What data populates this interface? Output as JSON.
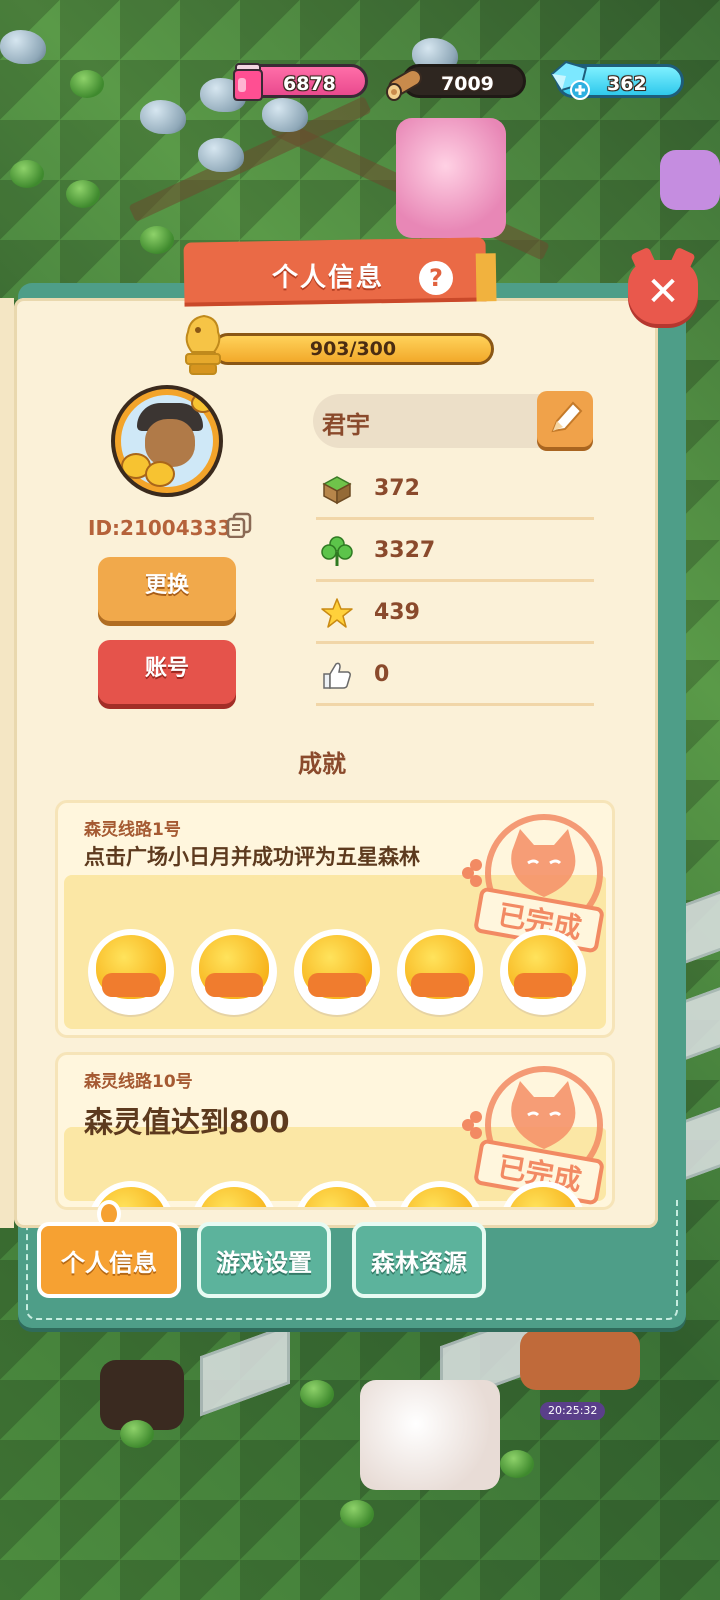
{
  "resources": {
    "ink": {
      "value": "6878",
      "icon": "ink-jar-icon"
    },
    "wood": {
      "value": "7009",
      "icon": "wood-log-icon"
    },
    "gem": {
      "value": "362",
      "icon": "blue-gem-plus-icon"
    }
  },
  "panel": {
    "title": "个人信息",
    "help_label": "?",
    "close_label": "✕"
  },
  "profile": {
    "level_progress_text": "903/300",
    "level_progress_fraction": 1.0,
    "user_id": "ID:21004333",
    "name": "君宇",
    "change_button": "更换",
    "account_button": "账号",
    "stats": [
      {
        "icon": "grass-block-icon",
        "value": "372"
      },
      {
        "icon": "clover-icon",
        "value": "3327"
      },
      {
        "icon": "star-icon",
        "value": "439"
      },
      {
        "icon": "thumbs-up-icon",
        "value": "0"
      }
    ]
  },
  "achievements": {
    "heading": "成就",
    "items": [
      {
        "subtitle": "森灵线路1号",
        "description": "点击广场小日月并成功评为五星森林",
        "stamp": "已完成",
        "rewards": 5
      },
      {
        "subtitle": "森灵线路10号",
        "description": "森灵值达到800",
        "stamp": "已完成",
        "rewards": 5
      }
    ]
  },
  "tabs": [
    {
      "label": "个人信息",
      "active": true
    },
    {
      "label": "游戏设置",
      "active": false
    },
    {
      "label": "森林资源",
      "active": false
    }
  ],
  "clock": "20:25:32",
  "colors": {
    "panel_green": "#4e9e88",
    "page_cream": "#fbf1d8",
    "title_orange": "#ea6a46",
    "text_brown": "#8a4a2c",
    "account_red": "#e5534b",
    "change_orange": "#f1a94b"
  }
}
